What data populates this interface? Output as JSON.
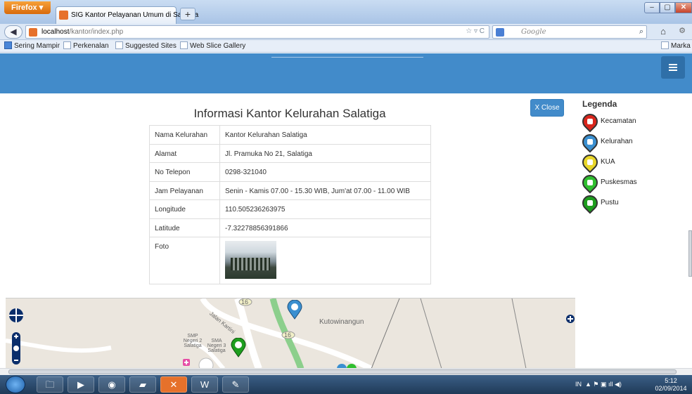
{
  "browser": {
    "app_button": "Firefox",
    "tab_title": "SIG Kantor Pelayanan Umum di Salatiga",
    "new_tab": "+",
    "url_host": "localhost",
    "url_path": "/kantor/index.php",
    "search_placeholder": "Google",
    "bookmarks": [
      "Sering Mampir",
      "Perkenalan",
      "Suggested Sites",
      "Web Slice Gallery"
    ],
    "bookmarks_right": "Marka"
  },
  "info": {
    "title": "Informasi Kantor Kelurahan Salatiga",
    "rows": [
      {
        "key": "Nama Kelurahan",
        "value": "Kantor Kelurahan Salatiga"
      },
      {
        "key": "Alamat",
        "value": "Jl. Pramuka No 21, Salatiga"
      },
      {
        "key": "No Telepon",
        "value": "0298-321040"
      },
      {
        "key": "Jam Pelayanan",
        "value": "Senin - Kamis 07.00 - 15.30 WIB, Jum'at 07.00 - 11.00 WIB"
      },
      {
        "key": "Longitude",
        "value": "110.505236263975"
      },
      {
        "key": "Latitude",
        "value": "-7.32278856391866"
      },
      {
        "key": "Foto",
        "value": ""
      }
    ]
  },
  "close_button": "X Close",
  "legend": {
    "title": "Legenda",
    "items": [
      {
        "label": "Kecamatan",
        "color": "#d9261c",
        "icon": "government-icon"
      },
      {
        "label": "Kelurahan",
        "color": "#3a8fd0",
        "icon": "building-icon"
      },
      {
        "label": "KUA",
        "color": "#e9d62a",
        "icon": "mosque-icon"
      },
      {
        "label": "Puskesmas",
        "color": "#2fbf2f",
        "icon": "health-center-icon"
      },
      {
        "label": "Pustu",
        "color": "#1e9e1e",
        "icon": "plus-icon"
      }
    ]
  },
  "map": {
    "labels": {
      "kutowinangun": "Kutowinangun",
      "jalan_kartini": "Jalan Kartini",
      "smp": "SMP Negeri 2 Salatiga",
      "sma": "SMA Negeri 3 Salatiga",
      "route_16a": "16",
      "route_16b": "16"
    }
  },
  "taskbar": {
    "tray_lang": "IN",
    "time": "5:12",
    "date": "02/09/2014"
  }
}
